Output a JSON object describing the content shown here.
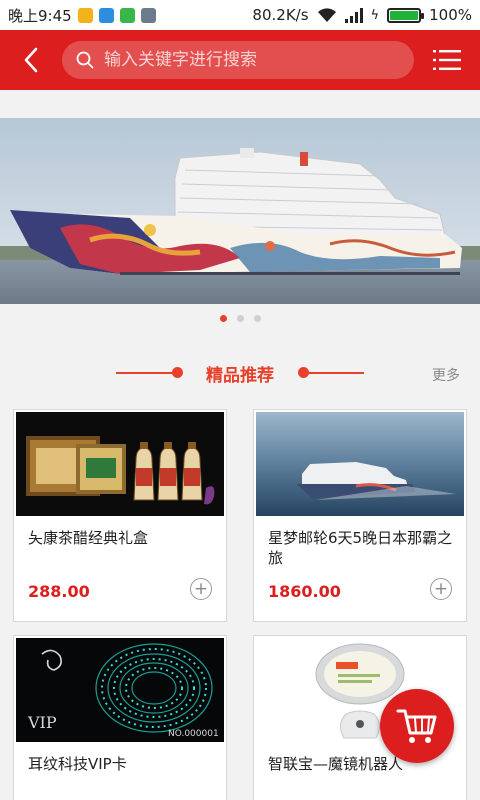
{
  "status_bar": {
    "time": "晚上9:45",
    "speed": "80.2K/s",
    "battery": "100%"
  },
  "header": {
    "search_placeholder": "输入关键字进行搜索"
  },
  "banner": {
    "slide_count": 3,
    "active_index": 0
  },
  "section": {
    "title": "精品推荐",
    "more": "更多"
  },
  "products": [
    {
      "name": "夨康茶醋经典礼盒",
      "price": "288.00"
    },
    {
      "name": "星梦邮轮6天5晚日本那霸之旅",
      "price": "1860.00"
    },
    {
      "name": "耳纹科技VIP卡",
      "price": "",
      "card_text": "NO.000001",
      "card_label": "VIP"
    },
    {
      "name": "智联宝—魔镜机器人",
      "price": ""
    }
  ],
  "colors": {
    "brand_red": "#dc1e1e",
    "accent_orange": "#e8402a"
  }
}
